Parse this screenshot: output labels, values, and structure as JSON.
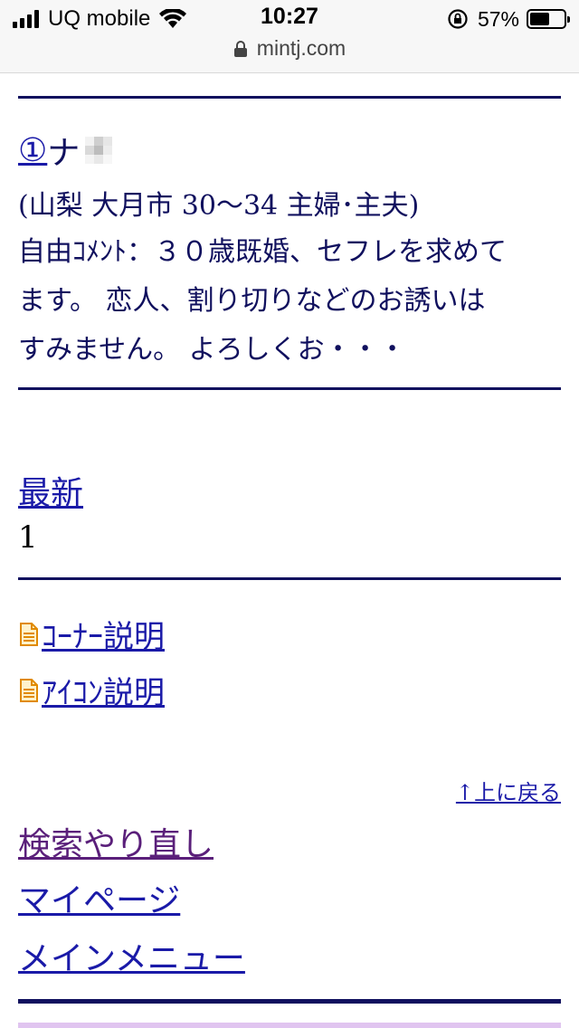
{
  "status_bar": {
    "carrier": "UQ mobile",
    "time": "10:27",
    "battery_percent": "57%",
    "battery_level": 0.57,
    "url": "mintj.com"
  },
  "profile": {
    "number_link": "①",
    "name_visible": "ナ",
    "meta": "(山梨 大月市 30～34 主婦･主夫)",
    "comment_lines": [
      "自由ｺﾒﾝﾄ：３０歳既婚、セフレを求めて",
      "ます。 恋人、割り切りなどのお誘いは",
      "すみません。 よろしくお・・・"
    ]
  },
  "pagination": {
    "latest_label": "最新",
    "page_number": "1"
  },
  "info_links": [
    {
      "label": "ｺｰﾅｰ説明"
    },
    {
      "label": "ｱｲｺﾝ説明"
    }
  ],
  "back_to_top": "↑上に戻る",
  "nav": {
    "retry_search": "検索やり直し",
    "my_page": "マイページ",
    "main_menu": "メインメニュー"
  },
  "colors": {
    "text": "#10105e",
    "link": "#1a1aa8",
    "visited_link": "#5a1f7a",
    "rule": "#10105e"
  }
}
